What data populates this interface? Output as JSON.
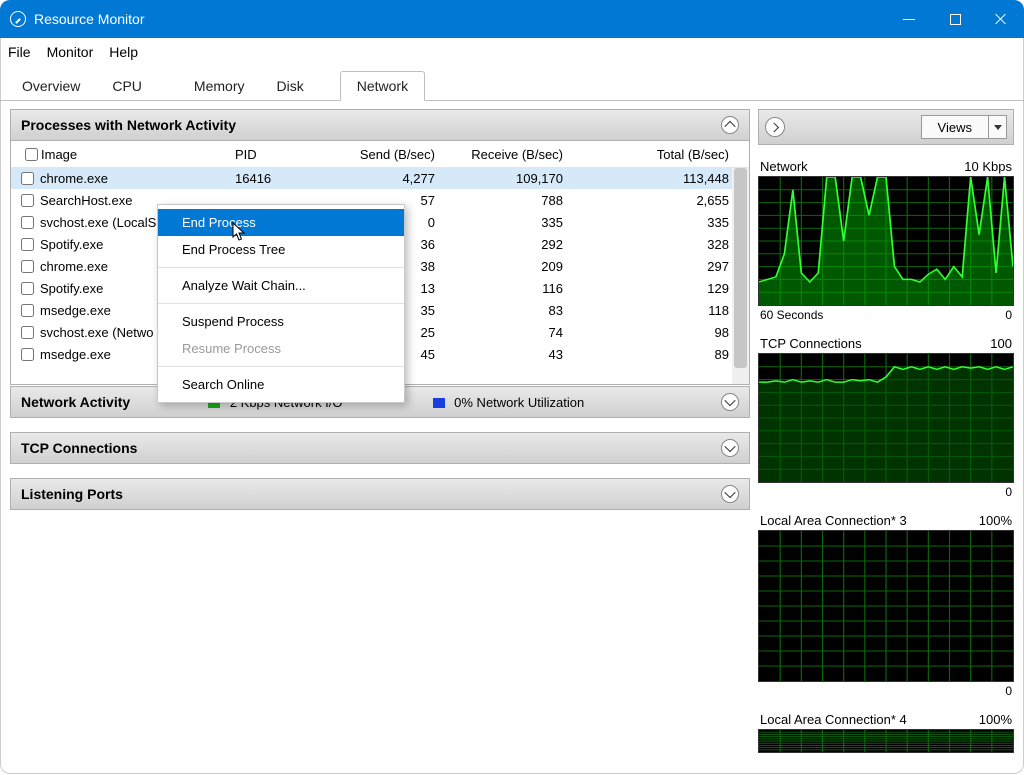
{
  "title": "Resource Monitor",
  "window_buttons": {
    "min": "minimize",
    "max": "maximize",
    "close": "close"
  },
  "menubar": [
    "File",
    "Monitor",
    "Help"
  ],
  "tabs": [
    "Overview",
    "CPU",
    "Memory",
    "Disk",
    "Network"
  ],
  "active_tab": 4,
  "proc_panel": {
    "title": "Processes with Network Activity",
    "cols": [
      "Image",
      "PID",
      "Send (B/sec)",
      "Receive (B/sec)",
      "Total (B/sec)"
    ],
    "rows": [
      {
        "image": "chrome.exe",
        "pid": "16416",
        "send": "4,277",
        "recv": "109,170",
        "total": "113,448",
        "sel": true
      },
      {
        "image": "SearchHost.exe",
        "pid": "",
        "send": "57",
        "recv": "788",
        "total": "2,655"
      },
      {
        "image": "svchost.exe (LocalS",
        "pid": "",
        "send": "0",
        "recv": "335",
        "total": "335"
      },
      {
        "image": "Spotify.exe",
        "pid": "",
        "send": "36",
        "recv": "292",
        "total": "328"
      },
      {
        "image": "chrome.exe",
        "pid": "",
        "send": "38",
        "recv": "209",
        "total": "297"
      },
      {
        "image": "Spotify.exe",
        "pid": "",
        "send": "13",
        "recv": "116",
        "total": "129"
      },
      {
        "image": "msedge.exe",
        "pid": "",
        "send": "35",
        "recv": "83",
        "total": "118"
      },
      {
        "image": "svchost.exe (Netwo",
        "pid": "",
        "send": "25",
        "recv": "74",
        "total": "98"
      },
      {
        "image": "msedge.exe",
        "pid": "",
        "send": "45",
        "recv": "43",
        "total": "89"
      }
    ]
  },
  "net_activity": {
    "title": "Network Activity",
    "legend1": "2 Kbps Network I/O",
    "legend2": "0% Network Utilization"
  },
  "tcp_section": {
    "title": "TCP Connections"
  },
  "ports_section": {
    "title": "Listening Ports"
  },
  "context_menu": {
    "items": [
      {
        "label": "End Process",
        "type": "item",
        "hover": true
      },
      {
        "label": "End Process Tree",
        "type": "item"
      },
      {
        "type": "sep"
      },
      {
        "label": "Analyze Wait Chain...",
        "type": "item"
      },
      {
        "type": "sep"
      },
      {
        "label": "Suspend Process",
        "type": "item"
      },
      {
        "label": "Resume Process",
        "type": "item",
        "disabled": true
      },
      {
        "type": "sep"
      },
      {
        "label": "Search Online",
        "type": "item"
      }
    ]
  },
  "views_button": "Views",
  "charts": [
    {
      "title": "Network",
      "max": "10 Kbps",
      "footer_left": "60 Seconds",
      "footer_right": "0",
      "type": "network"
    },
    {
      "title": "TCP Connections",
      "max": "100",
      "footer_left": "",
      "footer_right": "0",
      "type": "tcp"
    },
    {
      "title": "Local Area Connection* 3",
      "max": "100%",
      "footer_left": "",
      "footer_right": "0",
      "type": "flat"
    },
    {
      "title": "Local Area Connection* 4",
      "max": "100%",
      "footer_left": "",
      "footer_right": "",
      "type": "flat-small"
    }
  ],
  "chart_data": [
    {
      "name": "Network",
      "type": "line",
      "ylim": [
        0,
        10
      ],
      "unit": "Kbps",
      "values_pct": [
        18,
        20,
        22,
        40,
        90,
        25,
        18,
        25,
        100,
        100,
        50,
        100,
        100,
        70,
        100,
        100,
        30,
        20,
        20,
        18,
        24,
        28,
        20,
        30,
        22,
        100,
        55,
        100,
        25,
        100,
        30
      ]
    },
    {
      "name": "TCP Connections",
      "type": "line",
      "ylim": [
        0,
        100
      ],
      "values_pct": [
        78,
        78,
        79,
        78,
        80,
        78,
        79,
        78,
        80,
        78,
        78,
        80,
        79,
        80,
        78,
        82,
        90,
        88,
        90,
        88,
        90,
        88,
        90,
        88,
        90,
        89,
        90,
        88,
        90,
        88,
        90
      ]
    },
    {
      "name": "Local Area Connection* 3",
      "type": "line",
      "ylim": [
        0,
        100
      ],
      "unit": "%",
      "values_pct": [
        0,
        0,
        0,
        0,
        0,
        0,
        0,
        0,
        0,
        0,
        0,
        0,
        0,
        0,
        0,
        0,
        0,
        0,
        0,
        0,
        0,
        0,
        0,
        0,
        0,
        0,
        0,
        0,
        0,
        0,
        0
      ]
    },
    {
      "name": "Local Area Connection* 4",
      "type": "line",
      "ylim": [
        0,
        100
      ],
      "unit": "%",
      "values_pct": [
        0,
        0,
        0,
        0,
        0,
        0,
        0,
        0,
        0,
        0,
        0,
        0,
        0,
        0,
        0,
        0,
        0,
        0,
        0,
        0,
        0,
        0,
        0,
        0,
        0,
        0,
        0,
        0,
        0,
        0,
        0
      ]
    }
  ]
}
